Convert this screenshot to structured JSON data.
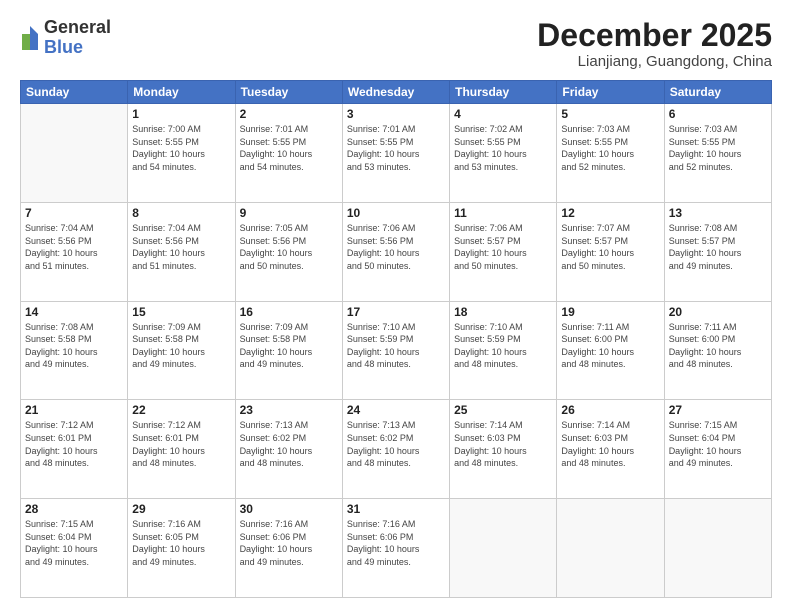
{
  "logo": {
    "general": "General",
    "blue": "Blue"
  },
  "header": {
    "month": "December 2025",
    "location": "Lianjiang, Guangdong, China"
  },
  "weekdays": [
    "Sunday",
    "Monday",
    "Tuesday",
    "Wednesday",
    "Thursday",
    "Friday",
    "Saturday"
  ],
  "weeks": [
    [
      {
        "day": "",
        "info": ""
      },
      {
        "day": "1",
        "info": "Sunrise: 7:00 AM\nSunset: 5:55 PM\nDaylight: 10 hours\nand 54 minutes."
      },
      {
        "day": "2",
        "info": "Sunrise: 7:01 AM\nSunset: 5:55 PM\nDaylight: 10 hours\nand 54 minutes."
      },
      {
        "day": "3",
        "info": "Sunrise: 7:01 AM\nSunset: 5:55 PM\nDaylight: 10 hours\nand 53 minutes."
      },
      {
        "day": "4",
        "info": "Sunrise: 7:02 AM\nSunset: 5:55 PM\nDaylight: 10 hours\nand 53 minutes."
      },
      {
        "day": "5",
        "info": "Sunrise: 7:03 AM\nSunset: 5:55 PM\nDaylight: 10 hours\nand 52 minutes."
      },
      {
        "day": "6",
        "info": "Sunrise: 7:03 AM\nSunset: 5:55 PM\nDaylight: 10 hours\nand 52 minutes."
      }
    ],
    [
      {
        "day": "7",
        "info": "Sunrise: 7:04 AM\nSunset: 5:56 PM\nDaylight: 10 hours\nand 51 minutes."
      },
      {
        "day": "8",
        "info": "Sunrise: 7:04 AM\nSunset: 5:56 PM\nDaylight: 10 hours\nand 51 minutes."
      },
      {
        "day": "9",
        "info": "Sunrise: 7:05 AM\nSunset: 5:56 PM\nDaylight: 10 hours\nand 50 minutes."
      },
      {
        "day": "10",
        "info": "Sunrise: 7:06 AM\nSunset: 5:56 PM\nDaylight: 10 hours\nand 50 minutes."
      },
      {
        "day": "11",
        "info": "Sunrise: 7:06 AM\nSunset: 5:57 PM\nDaylight: 10 hours\nand 50 minutes."
      },
      {
        "day": "12",
        "info": "Sunrise: 7:07 AM\nSunset: 5:57 PM\nDaylight: 10 hours\nand 50 minutes."
      },
      {
        "day": "13",
        "info": "Sunrise: 7:08 AM\nSunset: 5:57 PM\nDaylight: 10 hours\nand 49 minutes."
      }
    ],
    [
      {
        "day": "14",
        "info": "Sunrise: 7:08 AM\nSunset: 5:58 PM\nDaylight: 10 hours\nand 49 minutes."
      },
      {
        "day": "15",
        "info": "Sunrise: 7:09 AM\nSunset: 5:58 PM\nDaylight: 10 hours\nand 49 minutes."
      },
      {
        "day": "16",
        "info": "Sunrise: 7:09 AM\nSunset: 5:58 PM\nDaylight: 10 hours\nand 49 minutes."
      },
      {
        "day": "17",
        "info": "Sunrise: 7:10 AM\nSunset: 5:59 PM\nDaylight: 10 hours\nand 48 minutes."
      },
      {
        "day": "18",
        "info": "Sunrise: 7:10 AM\nSunset: 5:59 PM\nDaylight: 10 hours\nand 48 minutes."
      },
      {
        "day": "19",
        "info": "Sunrise: 7:11 AM\nSunset: 6:00 PM\nDaylight: 10 hours\nand 48 minutes."
      },
      {
        "day": "20",
        "info": "Sunrise: 7:11 AM\nSunset: 6:00 PM\nDaylight: 10 hours\nand 48 minutes."
      }
    ],
    [
      {
        "day": "21",
        "info": "Sunrise: 7:12 AM\nSunset: 6:01 PM\nDaylight: 10 hours\nand 48 minutes."
      },
      {
        "day": "22",
        "info": "Sunrise: 7:12 AM\nSunset: 6:01 PM\nDaylight: 10 hours\nand 48 minutes."
      },
      {
        "day": "23",
        "info": "Sunrise: 7:13 AM\nSunset: 6:02 PM\nDaylight: 10 hours\nand 48 minutes."
      },
      {
        "day": "24",
        "info": "Sunrise: 7:13 AM\nSunset: 6:02 PM\nDaylight: 10 hours\nand 48 minutes."
      },
      {
        "day": "25",
        "info": "Sunrise: 7:14 AM\nSunset: 6:03 PM\nDaylight: 10 hours\nand 48 minutes."
      },
      {
        "day": "26",
        "info": "Sunrise: 7:14 AM\nSunset: 6:03 PM\nDaylight: 10 hours\nand 48 minutes."
      },
      {
        "day": "27",
        "info": "Sunrise: 7:15 AM\nSunset: 6:04 PM\nDaylight: 10 hours\nand 49 minutes."
      }
    ],
    [
      {
        "day": "28",
        "info": "Sunrise: 7:15 AM\nSunset: 6:04 PM\nDaylight: 10 hours\nand 49 minutes."
      },
      {
        "day": "29",
        "info": "Sunrise: 7:16 AM\nSunset: 6:05 PM\nDaylight: 10 hours\nand 49 minutes."
      },
      {
        "day": "30",
        "info": "Sunrise: 7:16 AM\nSunset: 6:06 PM\nDaylight: 10 hours\nand 49 minutes."
      },
      {
        "day": "31",
        "info": "Sunrise: 7:16 AM\nSunset: 6:06 PM\nDaylight: 10 hours\nand 49 minutes."
      },
      {
        "day": "",
        "info": ""
      },
      {
        "day": "",
        "info": ""
      },
      {
        "day": "",
        "info": ""
      }
    ]
  ]
}
